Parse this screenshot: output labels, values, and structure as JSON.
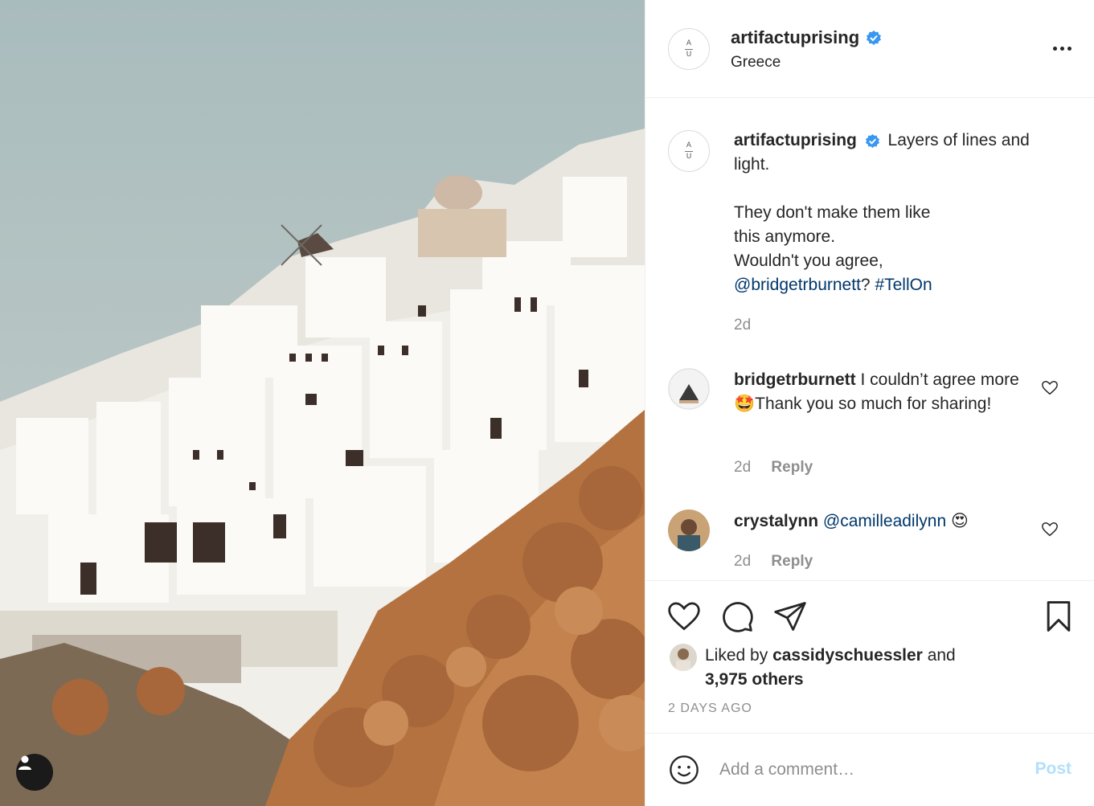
{
  "post": {
    "username": "artifactuprising",
    "location": "Greece",
    "avatar_letters": {
      "top": "A",
      "bottom": "U"
    }
  },
  "caption": {
    "username": "artifactuprising",
    "line1": "Layers of lines and light.",
    "line2": "They don't make them like this anymore.",
    "line3": "Wouldn't you agree,",
    "mention": "@bridgetrburnett",
    "qmark": "?",
    "hashtag": "#TellOn",
    "time": "2d"
  },
  "comments": [
    {
      "username": "bridgetrburnett",
      "text_a": "I couldn’t agree more",
      "emoji": "🤩",
      "text_b": "Thank you so much for sharing!",
      "time": "2d",
      "reply_label": "Reply"
    },
    {
      "username": "crystalynn",
      "mention": "@camilleadilynn",
      "emoji": "😍",
      "time": "2d",
      "reply_label": "Reply"
    }
  ],
  "likes": {
    "prefix": "Liked by",
    "user": "cassidyschuessler",
    "and": "and",
    "others": "3,975 others"
  },
  "date_label": "2 DAYS AGO",
  "add_comment": {
    "placeholder": "Add a comment…",
    "post_label": "Post"
  },
  "colors": {
    "link": "#00376b",
    "verified": "#3897f0",
    "post_disabled": "#b2dffc",
    "muted": "#8e8e8e"
  },
  "icons": [
    "heart-icon",
    "comment-icon",
    "share-icon",
    "bookmark-icon",
    "smiley-icon",
    "more-options-icon",
    "verified-badge-icon",
    "user-tag-icon"
  ]
}
